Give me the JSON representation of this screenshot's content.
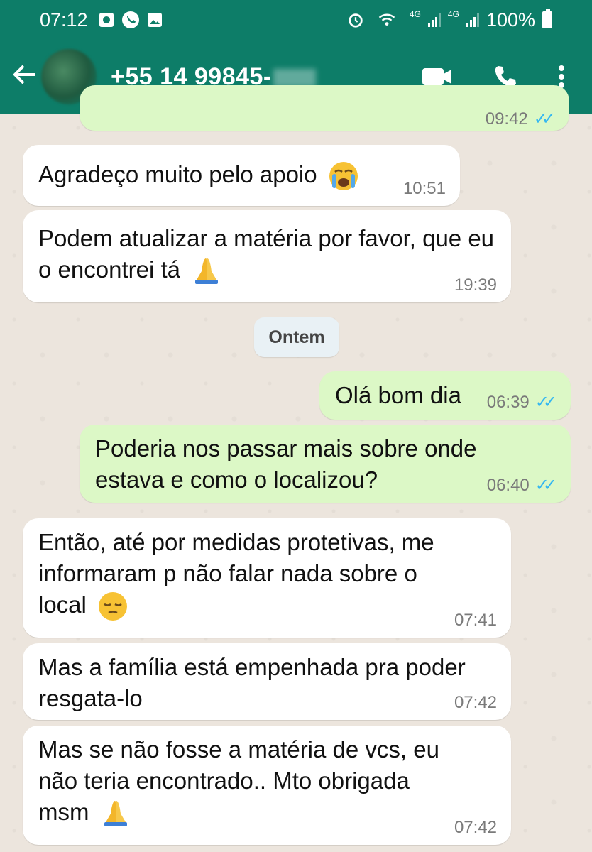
{
  "status_bar": {
    "time": "07:12",
    "network_1": "4G",
    "network_2": "4G",
    "battery": "100%"
  },
  "header": {
    "back_icon": "arrow-left",
    "contact_name": "+55 14 99845-",
    "video_icon": "video-camera",
    "call_icon": "phone",
    "menu_icon": "dots-vertical",
    "color": "#0d7d68"
  },
  "day_chip": "Ontem",
  "messages": [
    {
      "direction": "out",
      "time": "09:42",
      "text": ""
    },
    {
      "direction": "in",
      "text": "Agradeço muito pelo apoio",
      "emoji": "loudly-crying-face",
      "time": "10:51"
    },
    {
      "direction": "in",
      "text": "Podem atualizar a matéria por favor, que eu o encontrei tá",
      "emoji": "folded-hands",
      "time": "19:39"
    },
    {
      "direction": "out",
      "text": "Olá bom dia",
      "time": "06:39",
      "read": true
    },
    {
      "direction": "out",
      "text": "Poderia nos passar mais sobre onde estava e como o localizou?",
      "time": "06:40",
      "read": true
    },
    {
      "direction": "in",
      "text": "Então, até por medidas protetivas, me informaram p não falar nada sobre o local",
      "emoji": "pensive-face",
      "time": "07:41"
    },
    {
      "direction": "in",
      "text": "Mas a família está empenhada pra poder resgata-lo",
      "time": "07:42"
    },
    {
      "direction": "in",
      "text": "Mas se não fosse a matéria de vcs, eu não teria encontrado.. Mto obrigada msm",
      "emoji": "folded-hands",
      "time": "07:42"
    }
  ],
  "colors": {
    "incoming": "#ffffff",
    "outgoing": "#dcf8c6",
    "read_ticks": "#34b7f1",
    "wallpaper": "#ece5dd"
  }
}
